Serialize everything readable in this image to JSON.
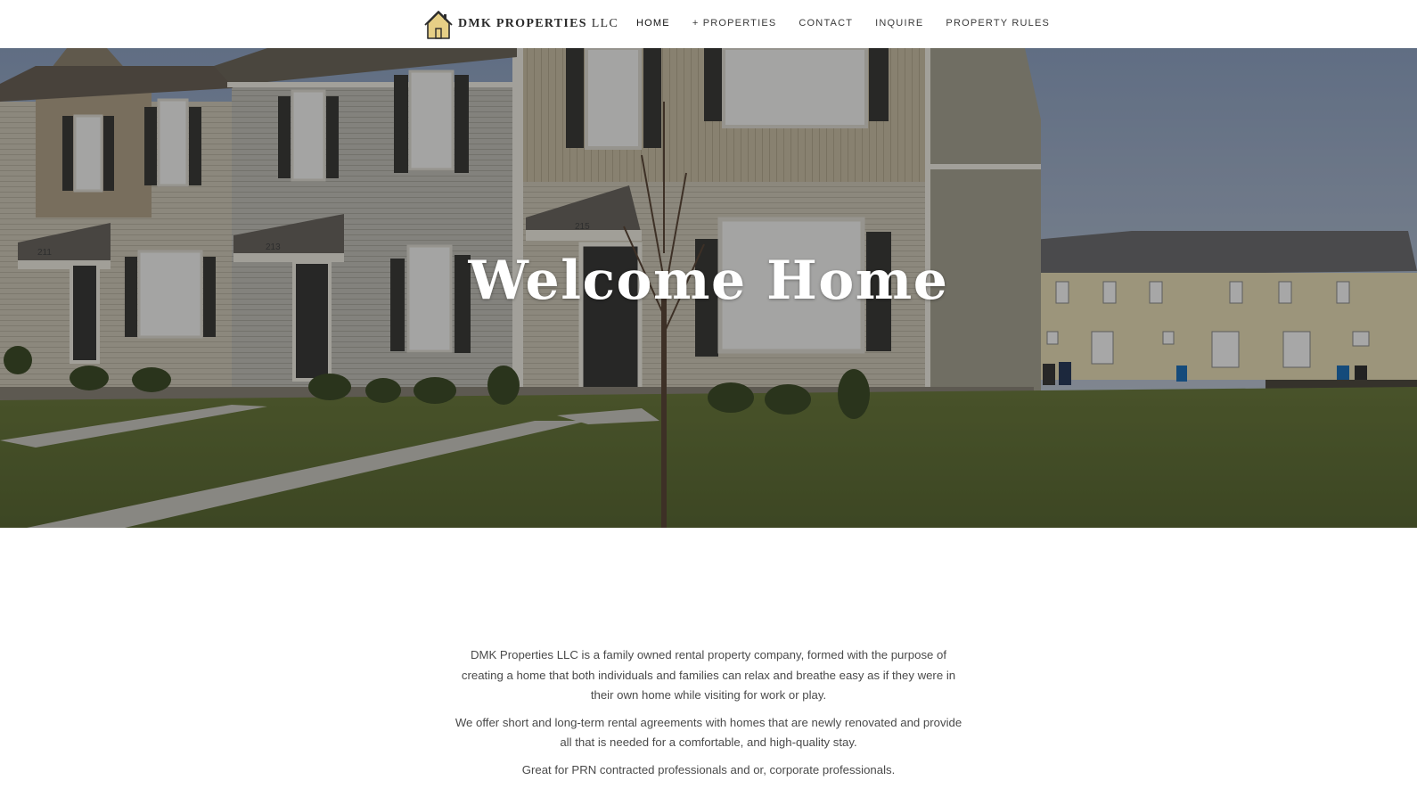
{
  "brand": {
    "name_bold": "DMK PROPERTIES",
    "name_suffix": "LLC",
    "logo_icon": "house-icon"
  },
  "nav": {
    "items": [
      {
        "label": "HOME",
        "active": true
      },
      {
        "label": "+ PROPERTIES",
        "active": false
      },
      {
        "label": "CONTACT",
        "active": false
      },
      {
        "label": "INQUIRE",
        "active": false
      },
      {
        "label": "PROPERTY RULES",
        "active": false
      }
    ]
  },
  "hero": {
    "title": "Welcome Home",
    "door_numbers": [
      "211",
      "213",
      "215"
    ]
  },
  "content": {
    "paragraphs": [
      "DMK Properties LLC is a family owned rental property company, formed with the purpose of creating a home that both individuals and families can relax and breathe easy as if they were in their own home while visiting for work or play.",
      "We offer short and long-term rental agreements with homes that are newly renovated and provide all that is needed for a comfortable, and high-quality stay.",
      "Great for PRN contracted professionals and or, corporate professionals."
    ]
  },
  "colors": {
    "header_bg": "#ffffff",
    "logo_roof": "#e6cf86",
    "hero_overlay": "rgba(0,0,0,0.32)",
    "body_text": "#4a4a4a"
  }
}
